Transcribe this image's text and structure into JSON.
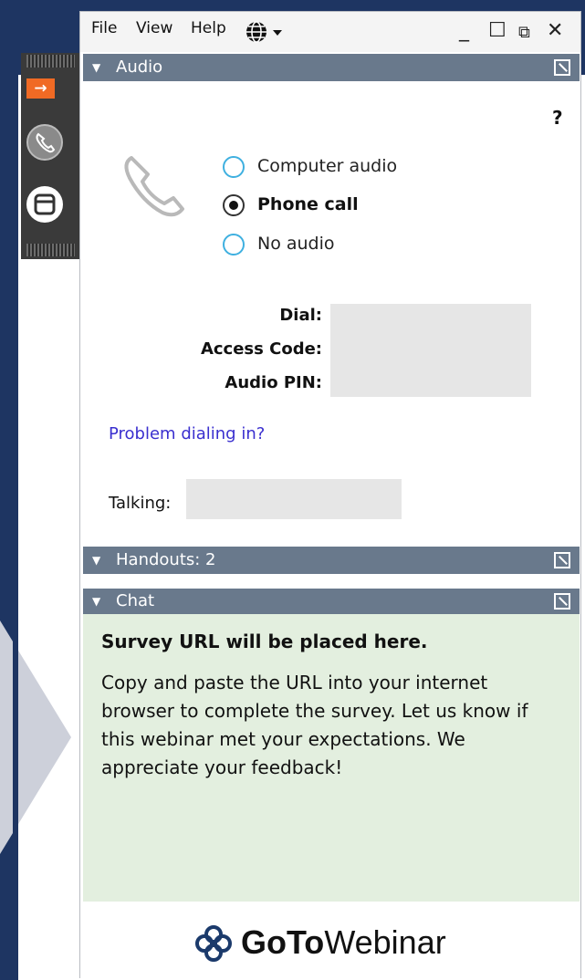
{
  "menu": {
    "file": "File",
    "view": "View",
    "help": "Help"
  },
  "window_controls": {
    "minimize": "_",
    "maximize": "☐",
    "popout": "⧉",
    "close": "✕"
  },
  "audio": {
    "title": "Audio",
    "help": "?",
    "options": [
      {
        "label": "Computer audio",
        "selected": false
      },
      {
        "label": "Phone call",
        "selected": true
      },
      {
        "label": "No audio",
        "selected": false
      }
    ],
    "dial_label": "Dial:",
    "access_code_label": "Access Code:",
    "audio_pin_label": "Audio PIN:",
    "problem_link": "Problem dialing in?",
    "talking_label": "Talking:"
  },
  "handouts": {
    "title": "Handouts: 2"
  },
  "chat": {
    "title": "Chat",
    "heading": "Survey URL will be placed here.",
    "message": "Copy and paste the URL into your internet browser to complete the survey. Let us know if this webinar met your expectations. We appreciate your feedback!"
  },
  "footer": {
    "brand_bold": "GoTo",
    "brand_light": "Webinar"
  },
  "sidebar": {
    "expand_icon": "→"
  },
  "colors": {
    "section_header": "#69798c",
    "chat_background": "#e3efdf",
    "accent_orange": "#f06a24",
    "slide_background": "#1e3562"
  }
}
